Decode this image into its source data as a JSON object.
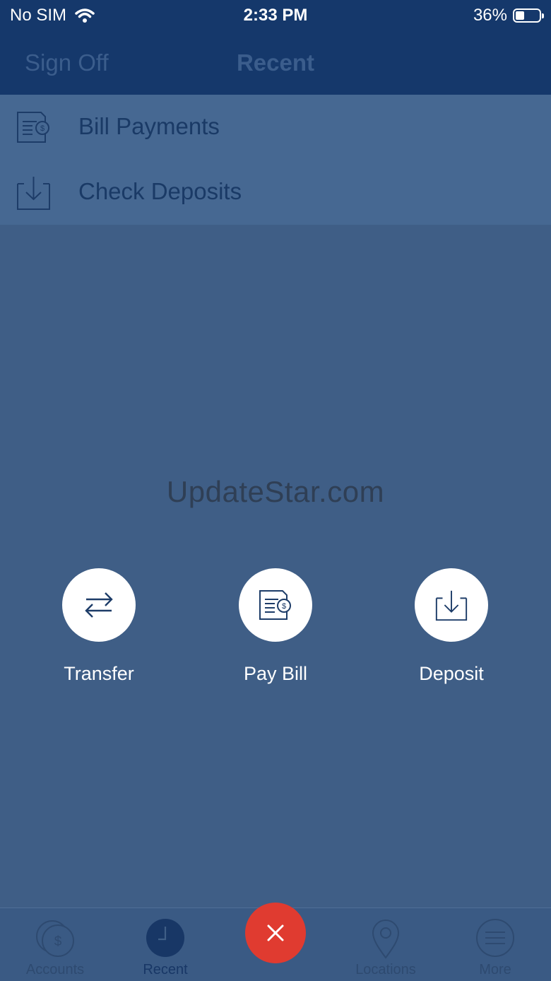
{
  "status_bar": {
    "carrier": "No SIM",
    "time": "2:33 PM",
    "battery": "36%",
    "battery_level": 0.36,
    "wifi_icon": "wifi-icon"
  },
  "nav": {
    "left_button": "Sign Off",
    "title": "Recent"
  },
  "menu": {
    "items": [
      {
        "label": "Bill Payments",
        "icon": "bill-icon"
      },
      {
        "label": "Check Deposits",
        "icon": "deposit-icon"
      }
    ]
  },
  "watermark": "UpdateStar.com",
  "actions": [
    {
      "label": "Transfer",
      "icon": "transfer-icon"
    },
    {
      "label": "Pay Bill",
      "icon": "bill-icon"
    },
    {
      "label": "Deposit",
      "icon": "deposit-icon"
    }
  ],
  "tabs": [
    {
      "label": "Accounts",
      "icon": "accounts-icon"
    },
    {
      "label": "Recent",
      "icon": "clock-icon",
      "active": true
    },
    {
      "label": "Locations",
      "icon": "location-pin-icon"
    },
    {
      "label": "More",
      "icon": "menu-icon"
    }
  ],
  "fab": {
    "icon": "close-icon"
  },
  "colors": {
    "nav_bg": "#15386b",
    "overlay_bg": "#3f5e86",
    "fab": "#e03b30"
  }
}
